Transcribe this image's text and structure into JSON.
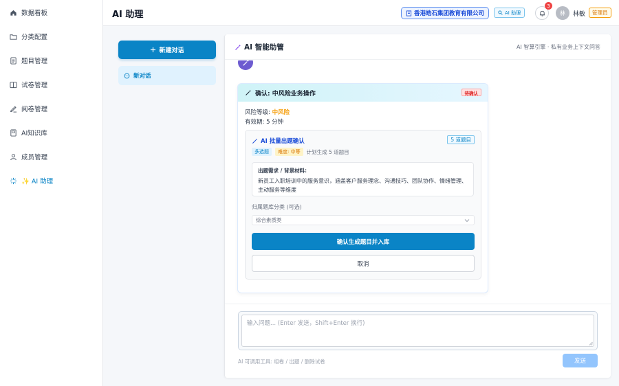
{
  "sidebar": {
    "items": [
      {
        "label": "数据看板",
        "icon": "home-icon"
      },
      {
        "label": "分类配置",
        "icon": "folder-icon"
      },
      {
        "label": "题目管理",
        "icon": "document-icon"
      },
      {
        "label": "试卷管理",
        "icon": "book-icon"
      },
      {
        "label": "阅卷管理",
        "icon": "pen-icon"
      },
      {
        "label": "AI知识库",
        "icon": "notebook-icon"
      },
      {
        "label": "成员管理",
        "icon": "user-icon"
      },
      {
        "label": "✨ AI 助理",
        "icon": "sparkle-icon"
      }
    ]
  },
  "header": {
    "title": "AI 助理",
    "org_name": "香港皓石集团教育有限公司",
    "ai_pill": "AI 助理",
    "notification_count": "3",
    "avatar_initial": "林",
    "user_name": "林敏",
    "role": "管理员"
  },
  "conversations": {
    "new_chat_label": "新建对话",
    "items": [
      {
        "label": "新对话"
      }
    ]
  },
  "chat": {
    "title": "AI 智能助管",
    "subtitle": "AI 智算引擎 · 私有业务上下文问答",
    "confirm_card": {
      "title": "确认: 中风险业务操作",
      "status": "待确认",
      "risk_label": "风险等级: ",
      "risk_value": "中风险",
      "expiry": "有效期: 5 分钟",
      "batch": {
        "title": "AI 批量出题确认",
        "count": "5 道题目",
        "type_tag": "多选题",
        "difficulty_tag": "难度: 中等",
        "plan_text": "计划生成 5 道题目",
        "req_label": "出题需求 / 背景材料:",
        "req_text": "新员工入职培训中的服务意识，涵盖客户服务理念、沟通技巧、团队协作、情绪管理、主动服务等维度",
        "category_label": "归属题库分类 (可选)",
        "category_value": "综合素质类",
        "confirm_label": "确认生成题目并入库",
        "cancel_label": "取消"
      }
    },
    "input": {
      "placeholder": "输入问题... (Enter 发送，Shift+Enter 换行)",
      "tools_hint": "AI 可调用工具: 组卷 / 出题 / 删除试卷",
      "send_label": "发送"
    }
  },
  "colors": {
    "accent": "#0a84c6",
    "warning": "#f59e0b",
    "danger": "#ef4444",
    "bot_avatar": "#6d5bd0"
  }
}
